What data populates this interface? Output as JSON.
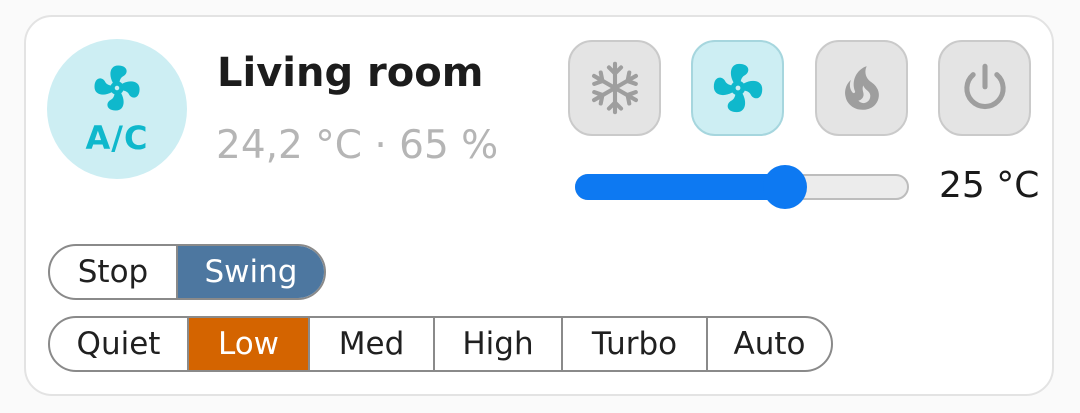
{
  "device": {
    "badge_label": "A/C",
    "badge_icon": "fan-icon",
    "name": "Living room",
    "current_readings": "24,2 °C · 65 %"
  },
  "modes": [
    {
      "name": "cool",
      "icon": "snowflake-icon",
      "active": false
    },
    {
      "name": "fan_only",
      "icon": "fan-icon",
      "active": true
    },
    {
      "name": "heat",
      "icon": "flame-icon",
      "active": false
    },
    {
      "name": "off",
      "icon": "power-icon",
      "active": false
    }
  ],
  "target_temperature": {
    "label": "25 °C",
    "slider_level": 0.63
  },
  "swing": {
    "options": [
      "Stop",
      "Swing"
    ],
    "selected": "Swing"
  },
  "fan_speed": {
    "options": [
      "Quiet",
      "Low",
      "Med",
      "High",
      "Turbo",
      "Auto"
    ],
    "selected": "Low"
  },
  "colors": {
    "accent_teal": "#0fb8cc",
    "badge_bg": "#cdeef3",
    "slider_blue": "#0d79f2",
    "swing_selected": "#4d77a0",
    "speed_selected": "#d46400",
    "inactive_icon": "#9e9e9e"
  }
}
